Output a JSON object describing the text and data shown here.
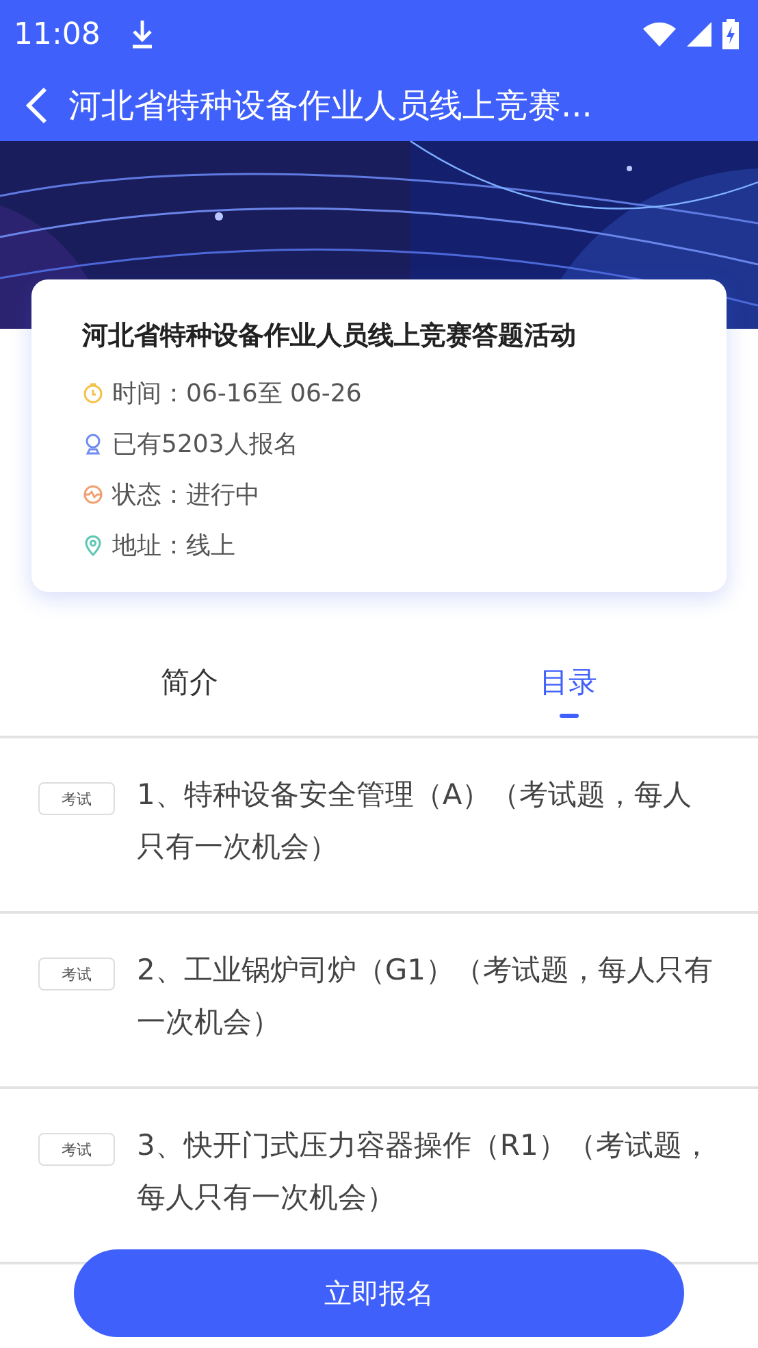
{
  "status_bar": {
    "time": "11:08"
  },
  "app_bar": {
    "title": "河北省特种设备作业人员线上竞赛..."
  },
  "info_card": {
    "title": "河北省特种设备作业人员线上竞赛答题活动",
    "rows": [
      {
        "kind": "time",
        "text": "时间：06-16至 06-26"
      },
      {
        "kind": "people",
        "text": "已有5203人报名"
      },
      {
        "kind": "status",
        "text": "状态：进行中"
      },
      {
        "kind": "location",
        "text": "地址：线上"
      }
    ]
  },
  "tabs": [
    {
      "label": "简介",
      "selected": false
    },
    {
      "label": "目录",
      "selected": true
    }
  ],
  "catalog": [
    {
      "tag": "考试",
      "title": "1、特种设备安全管理（A）（考试题，每人只有一次机会）"
    },
    {
      "tag": "考试",
      "title": "2、工业锅炉司炉（G1）（考试题，每人只有一次机会）"
    },
    {
      "tag": "考试",
      "title": "3、快开门式压力容器操作（R1）（考试题，每人只有一次机会）"
    }
  ],
  "signup_button": "立即报名"
}
